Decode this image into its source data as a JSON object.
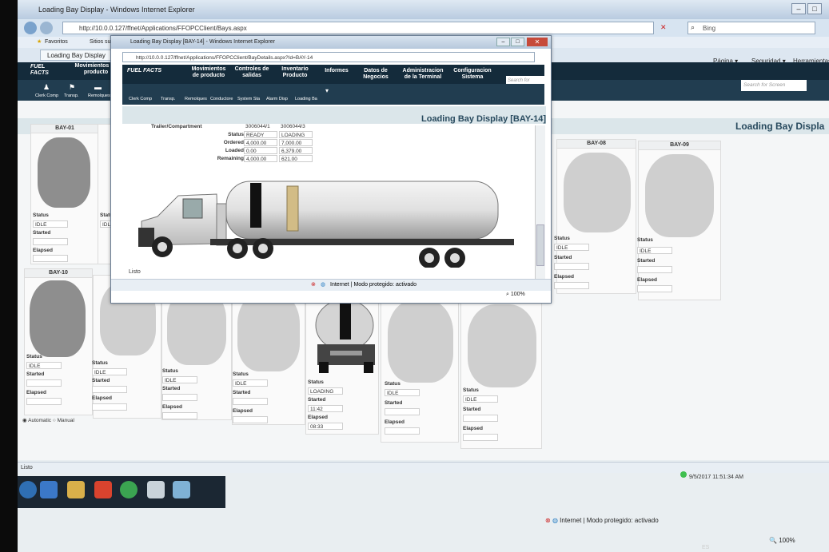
{
  "window": {
    "title": "Loading Bay Display - Windows Internet Explorer",
    "url": "http://10.0.0.127/ffnet/Applications/FFOPCClient/Bays.aspx",
    "search": "Bing"
  },
  "favorites": {
    "label": "Favoritos",
    "suggested": "Sitios suger"
  },
  "tab": {
    "label": "Loading Bay Display"
  },
  "cmdbar": {
    "page": "Página ▾",
    "security": "Seguridad ▾",
    "tools": "Herramientas ▾"
  },
  "app": {
    "logo": "FUEL FACTS",
    "nav": [
      "Movimientos de producto",
      "Controles de salidas",
      "Inventario Producto",
      "Informes",
      "Datos de Negocios",
      "Administracion de la Terminal",
      "Configuracion Sistema"
    ],
    "tools": [
      "Clerk Comp",
      "Transp.",
      "Remolques",
      "Conductore",
      "System Sta",
      "Alarm Disp",
      "Loading Ba"
    ],
    "search_placeholder": "Search for Screen",
    "page_title": "Loading Bay Displa"
  },
  "bays_top": [
    {
      "label": "BAY-01",
      "status": "IDLE"
    },
    {
      "label": "",
      "status": "IDLE"
    },
    {
      "label": "BAY-08",
      "status": "IDLE"
    },
    {
      "label": "BAY-09",
      "status": "IDLE"
    }
  ],
  "bays_bottom": [
    {
      "label": "BAY-10",
      "status": "IDLE",
      "started": "",
      "elapsed": ""
    },
    {
      "label": "",
      "status": "IDLE",
      "started": "",
      "elapsed": ""
    },
    {
      "label": "",
      "status": "IDLE",
      "started": "",
      "elapsed": ""
    },
    {
      "label": "",
      "status": "IDLE",
      "started": "",
      "elapsed": ""
    },
    {
      "label": "",
      "status": "LOADING",
      "started": "11:42",
      "elapsed": "08:33"
    },
    {
      "label": "",
      "status": "IDLE",
      "started": "",
      "elapsed": ""
    },
    {
      "label": "",
      "status": "IDLE",
      "started": "",
      "elapsed": ""
    }
  ],
  "field_labels": {
    "status": "Status",
    "started": "Started",
    "elapsed": "Elapsed"
  },
  "mode": {
    "automatic": "Automatic",
    "manual": "Manual"
  },
  "statusbar": {
    "text": "Listo",
    "timestamp": "9/5/2017 11:51:34 AM",
    "zone": "Internet | Modo protegido: activado",
    "zoom": "100%",
    "lang": "ES"
  },
  "popup": {
    "title": "Loading Bay Display [BAY-14] - Windows Internet Explorer",
    "url": "http://10.0.0.127/ffnet/Applications/FFOPCClient/BayDetails.aspx?Id=BAY-14",
    "header": "Loading Bay Display [BAY-14]",
    "rows": [
      {
        "label": "Trailer/Compartment",
        "v1": "3006044/1",
        "v2": "3006044/3"
      },
      {
        "label": "Status",
        "v1": "READY",
        "v2": "LOADING"
      },
      {
        "label": "Ordered",
        "v1": "4,000.00",
        "v2": "7,000.00"
      },
      {
        "label": "Loaded",
        "v1": "0.00",
        "v2": "6,379.00"
      },
      {
        "label": "Remaining",
        "v1": "4,000.00",
        "v2": "621.00"
      }
    ],
    "status": "Listo",
    "zone": "Internet | Modo protegido: activado",
    "zoom": "100%"
  }
}
